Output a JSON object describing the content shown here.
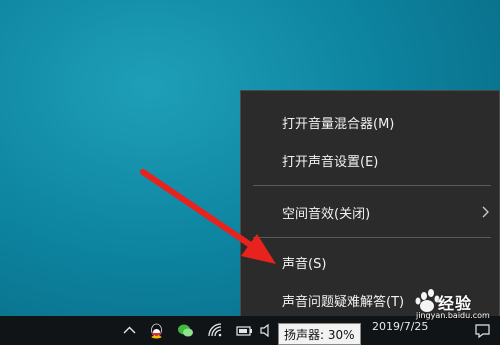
{
  "menu": {
    "items": [
      {
        "label": "打开音量混合器(M)"
      },
      {
        "label": "打开声音设置(E)"
      },
      {
        "label": "空间音效(关闭)"
      },
      {
        "label": "声音(S)"
      },
      {
        "label": "声音问题疑难解答(T)"
      }
    ]
  },
  "taskbar": {
    "clock": "2019/7/25",
    "tray_icons": [
      "chevron-up-icon",
      "qq-icon",
      "wechat-icon",
      "wifi-icon",
      "battery-icon",
      "speaker-icon",
      "notification-icon"
    ]
  },
  "tooltip": {
    "text": "扬声器: 30%"
  },
  "watermark": {
    "brand": "Baidu",
    "label": "经验",
    "url": "jingyan.baidu.com"
  },
  "colors": {
    "menu_bg": "#2b2b2b",
    "menu_text": "#f2f2f2",
    "arrow": "#e8231e",
    "desktop": "#0d84a0"
  }
}
